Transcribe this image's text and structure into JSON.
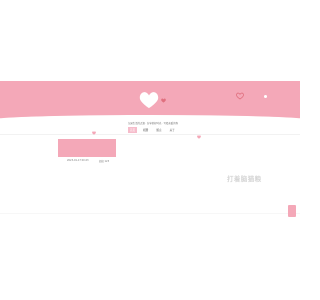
{
  "header": {
    "top_right_mark": "..."
  },
  "site": {
    "description": "记录生活的点滴 · 分享美好时光 · 写给亲爱的你",
    "nav": [
      {
        "label": "首页",
        "active": true
      },
      {
        "label": "相册",
        "active": false
      },
      {
        "label": "留言",
        "active": false
      },
      {
        "label": "关于",
        "active": false
      }
    ]
  },
  "post": {
    "date": "2023-01-17 00:23",
    "views": "阅读 123"
  },
  "watermark": "打着脑猫粮",
  "colors": {
    "accent": "#f4a8b8",
    "accent_light": "#f6bccb",
    "background": "#ffffff"
  },
  "icons": {
    "logo": "heart-icon",
    "decorations": [
      "small-heart-icon",
      "heart-outline-icon"
    ],
    "scroll_tab": "back-to-top-icon"
  }
}
